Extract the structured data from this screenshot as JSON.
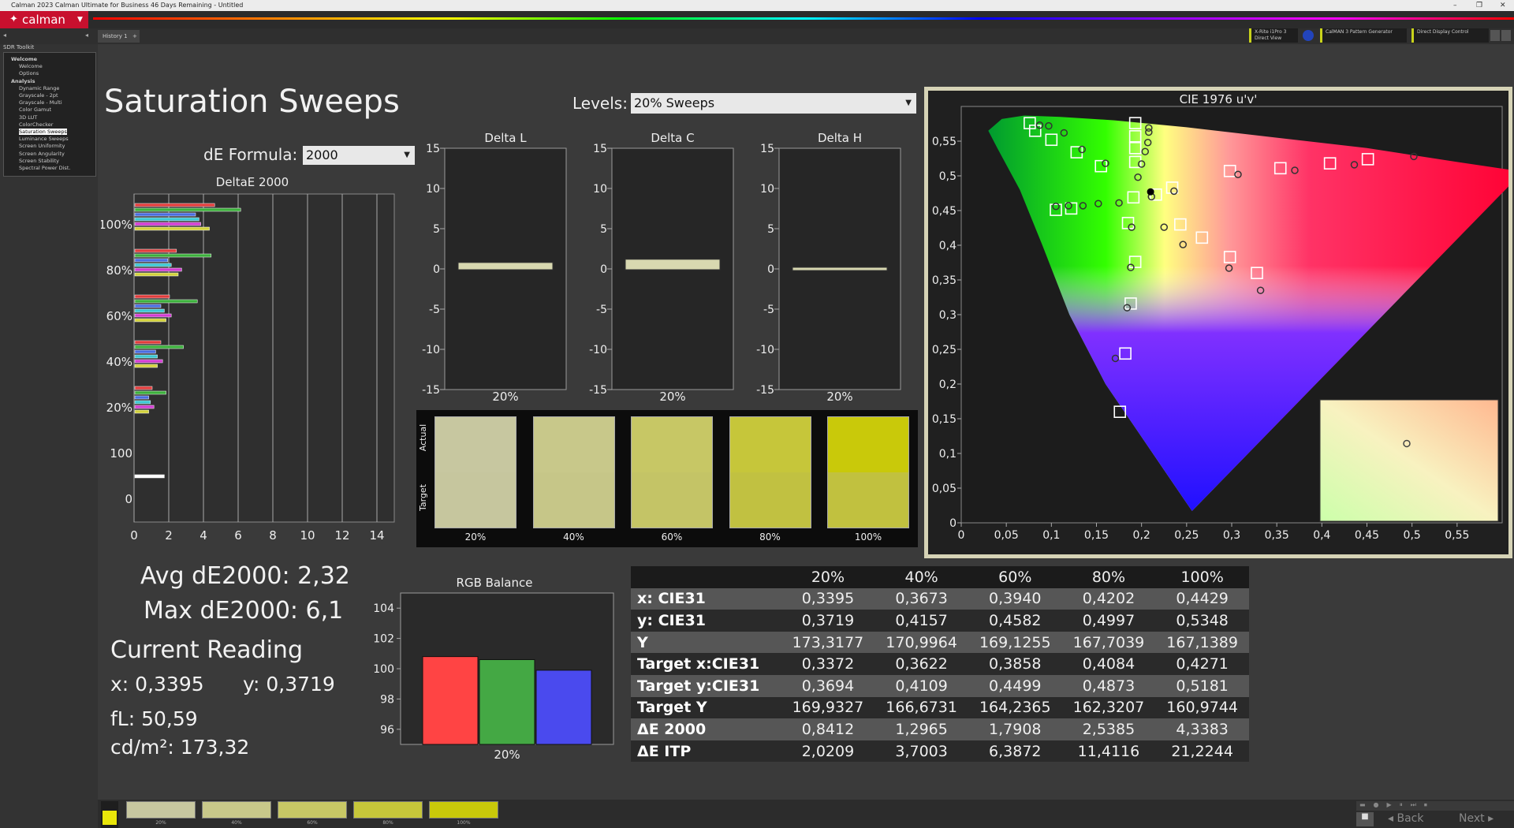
{
  "window": {
    "title": "Calman 2023 Calman Ultimate for Business 46 Days Remaining - Untitled"
  },
  "logo": {
    "text": "calman"
  },
  "tabs": [
    {
      "label": "History 1"
    }
  ],
  "devices": [
    {
      "label": "X-Rite i1Pro 3",
      "sub": "Direct View"
    },
    {
      "label": "CalMAN 3 Pattern Generator",
      "sub": ""
    },
    {
      "label": "Direct Display Control",
      "sub": ""
    }
  ],
  "sidebar": {
    "header": "SDR Toolkit",
    "items": [
      {
        "label": "Welcome",
        "level": 0
      },
      {
        "label": "Welcome",
        "level": 1
      },
      {
        "label": "Options",
        "level": 1
      },
      {
        "label": "Analysis",
        "level": 0
      },
      {
        "label": "Dynamic Range",
        "level": 1
      },
      {
        "label": "Grayscale - 2pt",
        "level": 1
      },
      {
        "label": "Grayscale - Multi",
        "level": 1
      },
      {
        "label": "Color Gamut",
        "level": 1
      },
      {
        "label": "3D LUT",
        "level": 1
      },
      {
        "label": "ColorChecker",
        "level": 1
      },
      {
        "label": "Saturation Sweeps",
        "level": 1,
        "selected": true
      },
      {
        "label": "Luminance Sweeps",
        "level": 1
      },
      {
        "label": "Screen Uniformity",
        "level": 1
      },
      {
        "label": "Screen Angularity",
        "level": 1
      },
      {
        "label": "Screen Stability",
        "level": 1
      },
      {
        "label": "Spectral Power Dist.",
        "level": 1
      }
    ]
  },
  "page": {
    "title": "Saturation Sweeps",
    "levels_label": "Levels:",
    "levels_value": "20% Sweeps",
    "de_formula_label": "dE Formula:",
    "de_formula_value": "2000"
  },
  "stats": {
    "avg": "Avg dE2000: 2,32",
    "max": "Max dE2000: 6,1",
    "current_reading": "Current Reading",
    "x": "x: 0,3395",
    "y": "y: 0,3719",
    "fl": "fL: 50,59",
    "cdm2": "cd/m²: 173,32"
  },
  "swatches": {
    "actual_label": "Actual",
    "target_label": "Target",
    "items": [
      {
        "label": "20%",
        "actual": "#c7c7a0",
        "target": "#c6c69e"
      },
      {
        "label": "40%",
        "actual": "#c8c88a",
        "target": "#c6c688"
      },
      {
        "label": "60%",
        "actual": "#c7c765",
        "target": "#c4c466"
      },
      {
        "label": "80%",
        "actual": "#c6c63a",
        "target": "#c1c141"
      },
      {
        "label": "100%",
        "actual": "#c9c90a",
        "target": "#c1c13f"
      }
    ]
  },
  "table": {
    "columns": [
      "",
      "20%",
      "40%",
      "60%",
      "80%",
      "100%"
    ],
    "rows": [
      [
        "x: CIE31",
        "0,3395",
        "0,3673",
        "0,3940",
        "0,4202",
        "0,4429"
      ],
      [
        "y: CIE31",
        "0,3719",
        "0,4157",
        "0,4582",
        "0,4997",
        "0,5348"
      ],
      [
        "Y",
        "173,3177",
        "170,9964",
        "169,1255",
        "167,7039",
        "167,1389"
      ],
      [
        "Target x:CIE31",
        "0,3372",
        "0,3622",
        "0,3858",
        "0,4084",
        "0,4271"
      ],
      [
        "Target y:CIE31",
        "0,3694",
        "0,4109",
        "0,4499",
        "0,4873",
        "0,5181"
      ],
      [
        "Target Y",
        "169,9327",
        "166,6731",
        "164,2365",
        "162,3207",
        "160,9744"
      ],
      [
        "ΔE 2000",
        "0,8412",
        "1,2965",
        "1,7908",
        "2,5385",
        "4,3383"
      ],
      [
        "ΔE ITP",
        "2,0209",
        "3,7003",
        "6,3872",
        "11,4116",
        "21,2244"
      ]
    ]
  },
  "bottom": {
    "swatch_labels": [
      "20%",
      "40%",
      "60%",
      "80%",
      "100%"
    ],
    "swatch_colors": [
      "#c7c7a0",
      "#c8c88a",
      "#c7c765",
      "#c6c63a",
      "#c9c90a"
    ],
    "back_label": "Back",
    "next_label": "Next"
  },
  "chart_data": [
    {
      "type": "bar",
      "title": "DeltaE 2000",
      "orientation": "horizontal",
      "xlim": [
        0,
        15
      ],
      "x_ticks": [
        "0",
        "2",
        "4",
        "6",
        "8",
        "10",
        "12",
        "14"
      ],
      "y_tick_labels": [
        "100%",
        "80%",
        "60%",
        "40%",
        "20%",
        "100",
        "0"
      ],
      "groups": [
        {
          "label": "100%",
          "bars": [
            {
              "color": "#e03c3c",
              "value": 4.6
            },
            {
              "color": "#3cb03c",
              "value": 6.1
            },
            {
              "color": "#4a6de0",
              "value": 3.5
            },
            {
              "color": "#3cc8d2",
              "value": 3.7
            },
            {
              "color": "#d23cd2",
              "value": 3.8
            },
            {
              "color": "#d2d23c",
              "value": 4.3
            }
          ]
        },
        {
          "label": "80%",
          "bars": [
            {
              "color": "#e03c3c",
              "value": 2.4
            },
            {
              "color": "#3cb03c",
              "value": 4.4
            },
            {
              "color": "#4a6de0",
              "value": 1.9
            },
            {
              "color": "#3cc8d2",
              "value": 2.1
            },
            {
              "color": "#d23cd2",
              "value": 2.7
            },
            {
              "color": "#d2d23c",
              "value": 2.5
            }
          ]
        },
        {
          "label": "60%",
          "bars": [
            {
              "color": "#e03c3c",
              "value": 2.0
            },
            {
              "color": "#3cb03c",
              "value": 3.6
            },
            {
              "color": "#4a6de0",
              "value": 1.5
            },
            {
              "color": "#3cc8d2",
              "value": 1.7
            },
            {
              "color": "#d23cd2",
              "value": 2.1
            },
            {
              "color": "#d2d23c",
              "value": 1.8
            }
          ]
        },
        {
          "label": "40%",
          "bars": [
            {
              "color": "#e03c3c",
              "value": 1.5
            },
            {
              "color": "#3cb03c",
              "value": 2.8
            },
            {
              "color": "#4a6de0",
              "value": 1.2
            },
            {
              "color": "#3cc8d2",
              "value": 1.3
            },
            {
              "color": "#d23cd2",
              "value": 1.6
            },
            {
              "color": "#d2d23c",
              "value": 1.3
            }
          ]
        },
        {
          "label": "20%",
          "bars": [
            {
              "color": "#e03c3c",
              "value": 1.0
            },
            {
              "color": "#3cb03c",
              "value": 1.8
            },
            {
              "color": "#4a6de0",
              "value": 0.8
            },
            {
              "color": "#3cc8d2",
              "value": 0.9
            },
            {
              "color": "#d23cd2",
              "value": 1.1
            },
            {
              "color": "#d2d23c",
              "value": 0.8
            }
          ]
        },
        {
          "label": "100",
          "bars": [
            {
              "color": "#ffffff",
              "value": 1.7
            }
          ]
        }
      ]
    },
    {
      "type": "bar",
      "title": "Delta L",
      "categories": [
        "20%"
      ],
      "values": [
        0.6
      ],
      "ylim": [
        -15,
        15
      ],
      "y_ticks": [
        "15",
        "10",
        "5",
        "0",
        "-5",
        "-10",
        "-15"
      ]
    },
    {
      "type": "bar",
      "title": "Delta C",
      "categories": [
        "20%"
      ],
      "values": [
        1.0
      ],
      "ylim": [
        -15,
        15
      ],
      "y_ticks": [
        "15",
        "10",
        "5",
        "0",
        "-5",
        "-10",
        "-15"
      ]
    },
    {
      "type": "bar",
      "title": "Delta H",
      "categories": [
        "20%"
      ],
      "values": [
        -0.1
      ],
      "ylim": [
        -15,
        15
      ],
      "y_ticks": [
        "15",
        "10",
        "5",
        "0",
        "-5",
        "-10",
        "-15"
      ]
    },
    {
      "type": "bar",
      "title": "RGB Balance",
      "categories": [
        "20%"
      ],
      "ylim": [
        95,
        105
      ],
      "y_ticks": [
        "104",
        "102",
        "100",
        "98",
        "96"
      ],
      "series": [
        {
          "color": "#ff4444",
          "values": [
            100.8
          ]
        },
        {
          "color": "#44a844",
          "values": [
            100.6
          ]
        },
        {
          "color": "#4a4aee",
          "values": [
            99.9
          ]
        }
      ]
    },
    {
      "type": "scatter",
      "title": "CIE 1976 u'v'",
      "xlim": [
        0,
        0.6
      ],
      "ylim": [
        0,
        0.6
      ],
      "x_ticks": [
        "0",
        "0,05",
        "0,1",
        "0,15",
        "0,2",
        "0,25",
        "0,3",
        "0,35",
        "0,4",
        "0,45",
        "0,5",
        "0,55"
      ],
      "y_ticks": [
        "0",
        "0,05",
        "0,1",
        "0,15",
        "0,2",
        "0,25",
        "0,3",
        "0,35",
        "0,4",
        "0,45",
        "0,5",
        "0,55"
      ],
      "targets": [
        [
          0.076,
          0.576
        ],
        [
          0.082,
          0.565
        ],
        [
          0.1,
          0.552
        ],
        [
          0.128,
          0.534
        ],
        [
          0.155,
          0.514
        ],
        [
          0.193,
          0.576
        ],
        [
          0.193,
          0.557
        ],
        [
          0.193,
          0.54
        ],
        [
          0.193,
          0.52
        ],
        [
          0.234,
          0.483
        ],
        [
          0.298,
          0.507
        ],
        [
          0.354,
          0.511
        ],
        [
          0.409,
          0.518
        ],
        [
          0.451,
          0.524
        ],
        [
          0.105,
          0.451
        ],
        [
          0.122,
          0.453
        ],
        [
          0.185,
          0.432
        ],
        [
          0.243,
          0.43
        ],
        [
          0.267,
          0.411
        ],
        [
          0.298,
          0.383
        ],
        [
          0.328,
          0.36
        ],
        [
          0.193,
          0.376
        ],
        [
          0.188,
          0.316
        ],
        [
          0.182,
          0.244
        ],
        [
          0.176,
          0.16
        ],
        [
          0.216,
          0.473
        ],
        [
          0.191,
          0.469
        ]
      ],
      "measured": [
        [
          0.087,
          0.573
        ],
        [
          0.097,
          0.572
        ],
        [
          0.114,
          0.562
        ],
        [
          0.134,
          0.538
        ],
        [
          0.16,
          0.518
        ],
        [
          0.208,
          0.569
        ],
        [
          0.208,
          0.563
        ],
        [
          0.207,
          0.548
        ],
        [
          0.204,
          0.535
        ],
        [
          0.2,
          0.517
        ],
        [
          0.196,
          0.498
        ],
        [
          0.236,
          0.478
        ],
        [
          0.307,
          0.502
        ],
        [
          0.37,
          0.508
        ],
        [
          0.436,
          0.516
        ],
        [
          0.502,
          0.528
        ],
        [
          0.105,
          0.456
        ],
        [
          0.119,
          0.457
        ],
        [
          0.135,
          0.457
        ],
        [
          0.152,
          0.46
        ],
        [
          0.175,
          0.461
        ],
        [
          0.189,
          0.426
        ],
        [
          0.225,
          0.426
        ],
        [
          0.246,
          0.401
        ],
        [
          0.297,
          0.367
        ],
        [
          0.332,
          0.335
        ],
        [
          0.188,
          0.368
        ],
        [
          0.184,
          0.31
        ],
        [
          0.171,
          0.237
        ],
        [
          0.211,
          0.47
        ]
      ],
      "current": [
        0.21,
        0.477
      ],
      "inset_point": [
        0.5,
        0.5
      ]
    }
  ]
}
